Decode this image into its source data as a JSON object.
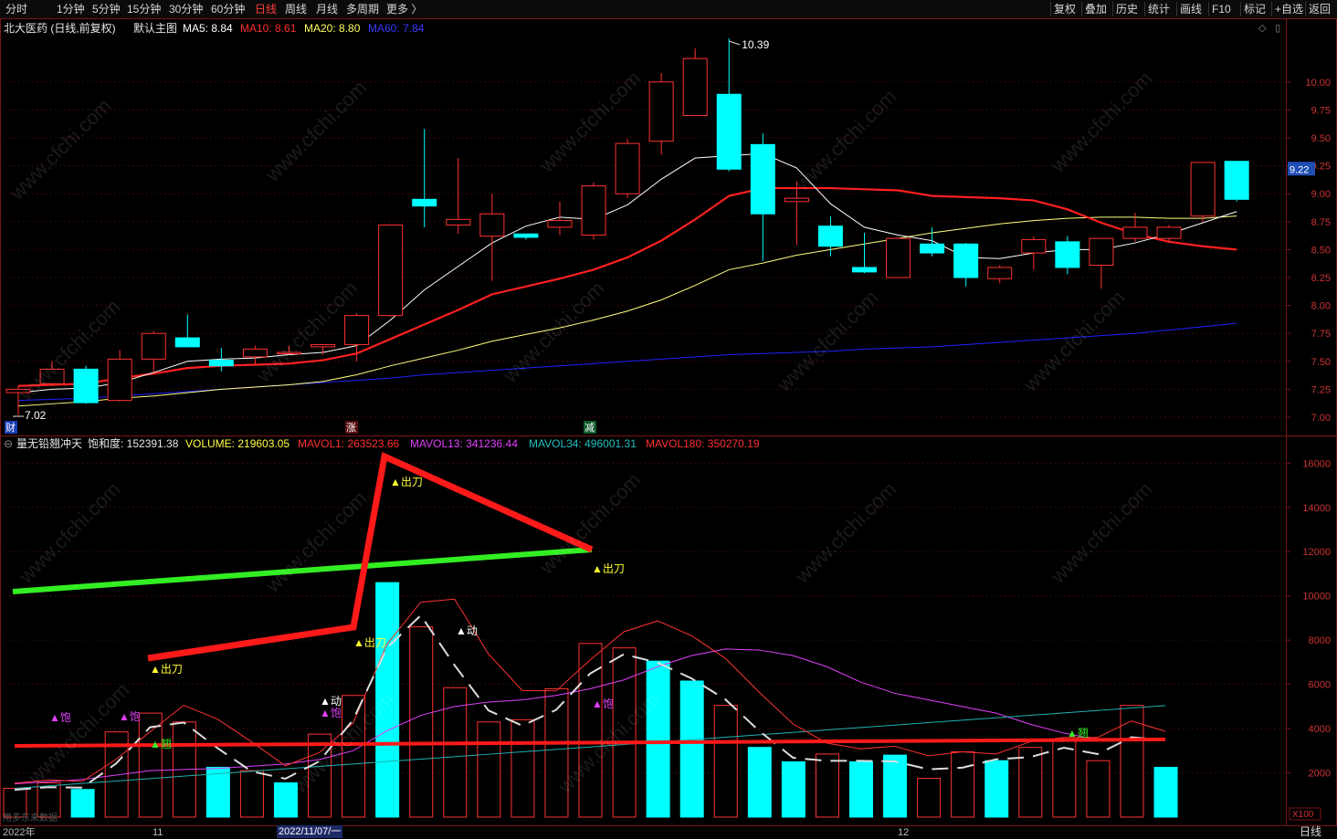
{
  "toolbar": {
    "periods": [
      "分时",
      "1分钟",
      "5分钟",
      "15分钟",
      "30分钟",
      "60分钟",
      "日线",
      "周线",
      "月线",
      "多周期",
      "更多 〉"
    ],
    "active_period": "日线",
    "right_buttons": [
      "复权",
      "叠加",
      "历史",
      "统计",
      "画线",
      "F10",
      "标记",
      "+自选",
      "返回"
    ]
  },
  "main_panel": {
    "stock": "北大医药 (日线,前复权)",
    "template": "默认主图",
    "ma5": "MA5: 8.84",
    "ma10": "MA10: 8.61",
    "ma20": "MA20: 8.80",
    "ma60": "MA60: 7.84",
    "high_label": "10.39",
    "low_label": "7.02",
    "last_price": "9.22",
    "markers": [
      "财",
      "涨",
      "减"
    ]
  },
  "sub_panel": {
    "indicator": "量无铅翘冲天",
    "saturation": "饱和度: 152391.38",
    "volume": "VOLUME: 219603.05",
    "mavol1": "MAVOL1: 263523.66",
    "mavol13": "MAVOL13: 341236.44",
    "mavol34": "MAVOL34: 496001.31",
    "mavol180": "MAVOL180: 350270.19",
    "unit": "X100",
    "signals": {
      "chudao": "▲出刀",
      "dong": "▲动",
      "bao": "▲饱",
      "qiao": "▲翘"
    },
    "watermark_note": "用多东来数据"
  },
  "bottom": {
    "year": "2022年",
    "month_nov": "11",
    "cursor_date": "2022/11/07/一",
    "month_dec": "12",
    "period_tag": "日线"
  },
  "watermark": "www.cfchi.com",
  "colors": {
    "up": "#ff3232",
    "down": "#00ffff",
    "ma5": "#ffffff",
    "ma10": "#ff2020",
    "ma20": "#ffff80",
    "ma60": "#2020ff",
    "purple": "#e040fb",
    "teal": "#20b0b0"
  },
  "chart_data": {
    "type": "candlestick",
    "price_axis": [
      7.0,
      7.25,
      7.5,
      7.75,
      8.0,
      8.25,
      8.5,
      8.75,
      9.0,
      9.25,
      9.5,
      9.75,
      10.0
    ],
    "candles": [
      {
        "o": 7.22,
        "h": 7.28,
        "l": 7.02,
        "c": 7.25
      },
      {
        "o": 7.3,
        "h": 7.5,
        "l": 7.28,
        "c": 7.43
      },
      {
        "o": 7.43,
        "h": 7.46,
        "l": 7.12,
        "c": 7.13
      },
      {
        "o": 7.15,
        "h": 7.6,
        "l": 7.14,
        "c": 7.52
      },
      {
        "o": 7.52,
        "h": 7.77,
        "l": 7.4,
        "c": 7.75
      },
      {
        "o": 7.71,
        "h": 7.92,
        "l": 7.63,
        "c": 7.63
      },
      {
        "o": 7.51,
        "h": 7.62,
        "l": 7.41,
        "c": 7.46
      },
      {
        "o": 7.54,
        "h": 7.64,
        "l": 7.47,
        "c": 7.61
      },
      {
        "o": 7.58,
        "h": 7.64,
        "l": 7.56,
        "c": 7.58
      },
      {
        "o": 7.63,
        "h": 7.65,
        "l": 7.56,
        "c": 7.65
      },
      {
        "o": 7.65,
        "h": 7.93,
        "l": 7.5,
        "c": 7.91
      },
      {
        "o": 7.91,
        "h": 8.72,
        "l": 7.9,
        "c": 8.72
      },
      {
        "o": 8.95,
        "h": 9.58,
        "l": 8.7,
        "c": 8.89
      },
      {
        "o": 8.72,
        "h": 9.32,
        "l": 8.64,
        "c": 8.77
      },
      {
        "o": 8.62,
        "h": 9.0,
        "l": 8.22,
        "c": 8.82
      },
      {
        "o": 8.64,
        "h": 8.64,
        "l": 8.59,
        "c": 8.61
      },
      {
        "o": 8.7,
        "h": 8.93,
        "l": 8.63,
        "c": 8.76
      },
      {
        "o": 8.63,
        "h": 9.1,
        "l": 8.59,
        "c": 9.07
      },
      {
        "o": 9.0,
        "h": 9.49,
        "l": 8.96,
        "c": 9.45
      },
      {
        "o": 9.47,
        "h": 10.08,
        "l": 9.35,
        "c": 10.0
      },
      {
        "o": 9.7,
        "h": 10.3,
        "l": 9.7,
        "c": 10.21
      },
      {
        "o": 9.89,
        "h": 10.39,
        "l": 9.2,
        "c": 9.22
      },
      {
        "o": 9.44,
        "h": 9.54,
        "l": 8.4,
        "c": 8.82
      },
      {
        "o": 8.93,
        "h": 9.11,
        "l": 8.54,
        "c": 8.96
      },
      {
        "o": 8.71,
        "h": 8.8,
        "l": 8.44,
        "c": 8.53
      },
      {
        "o": 8.34,
        "h": 8.65,
        "l": 8.29,
        "c": 8.3
      },
      {
        "o": 8.25,
        "h": 8.6,
        "l": 8.25,
        "c": 8.6
      },
      {
        "o": 8.55,
        "h": 8.7,
        "l": 8.44,
        "c": 8.47
      },
      {
        "o": 8.55,
        "h": 8.56,
        "l": 8.17,
        "c": 8.25
      },
      {
        "o": 8.24,
        "h": 8.36,
        "l": 8.2,
        "c": 8.34
      },
      {
        "o": 8.47,
        "h": 8.62,
        "l": 8.32,
        "c": 8.59
      },
      {
        "o": 8.57,
        "h": 8.62,
        "l": 8.28,
        "c": 8.34
      },
      {
        "o": 8.36,
        "h": 8.6,
        "l": 8.15,
        "c": 8.6
      },
      {
        "o": 8.6,
        "h": 8.83,
        "l": 8.57,
        "c": 8.7
      },
      {
        "o": 8.6,
        "h": 8.72,
        "l": 8.56,
        "c": 8.7
      },
      {
        "o": 8.8,
        "h": 9.28,
        "l": 8.75,
        "c": 9.28
      },
      {
        "o": 9.29,
        "h": 9.29,
        "l": 8.93,
        "c": 8.95
      }
    ],
    "ma5": [
      7.22,
      7.25,
      7.26,
      7.31,
      7.4,
      7.5,
      7.52,
      7.53,
      7.56,
      7.58,
      7.64,
      7.87,
      8.14,
      8.35,
      8.56,
      8.71,
      8.79,
      8.77,
      8.9,
      9.13,
      9.32,
      9.34,
      9.36,
      9.23,
      8.91,
      8.7,
      8.63,
      8.58,
      8.43,
      8.42,
      8.47,
      8.5,
      8.5,
      8.56,
      8.64,
      8.74,
      8.84
    ],
    "ma10": [
      7.28,
      7.29,
      7.3,
      7.35,
      7.39,
      7.44,
      7.46,
      7.47,
      7.48,
      7.51,
      7.57,
      7.7,
      7.83,
      7.96,
      8.1,
      8.17,
      8.24,
      8.32,
      8.43,
      8.58,
      8.77,
      8.98,
      9.05,
      9.05,
      9.05,
      9.04,
      9.03,
      8.98,
      8.97,
      8.96,
      8.94,
      8.86,
      8.74,
      8.64,
      8.57,
      8.53,
      8.5,
      8.49,
      8.49,
      8.56,
      8.61
    ],
    "ma20": [
      7.1,
      7.12,
      7.14,
      7.17,
      7.19,
      7.22,
      7.25,
      7.27,
      7.29,
      7.32,
      7.38,
      7.46,
      7.53,
      7.6,
      7.68,
      7.74,
      7.8,
      7.87,
      7.95,
      8.05,
      8.18,
      8.32,
      8.38,
      8.45,
      8.5,
      8.55,
      8.6,
      8.65,
      8.69,
      8.73,
      8.76,
      8.78,
      8.79,
      8.79,
      8.78,
      8.78,
      8.8
    ],
    "ma60": [
      7.15,
      7.16,
      7.17,
      7.19,
      7.21,
      7.23,
      7.25,
      7.27,
      7.29,
      7.31,
      7.33,
      7.35,
      7.38,
      7.4,
      7.42,
      7.44,
      7.46,
      7.48,
      7.5,
      7.52,
      7.54,
      7.56,
      7.57,
      7.58,
      7.59,
      7.61,
      7.62,
      7.63,
      7.65,
      7.67,
      7.69,
      7.71,
      7.73,
      7.75,
      7.78,
      7.81,
      7.84
    ],
    "vol_axis": [
      2000,
      4000,
      6000,
      8000,
      10000,
      12000,
      14000,
      16000
    ],
    "volumes": [
      1300,
      1550,
      1250,
      3850,
      4700,
      4300,
      2250,
      2100,
      1550,
      3750,
      5500,
      10600,
      8600,
      5850,
      4300,
      4400,
      5800,
      7850,
      7650,
      7050,
      6150,
      5050,
      3150,
      2500,
      2850,
      2500,
      2800,
      1750,
      2950,
      2550,
      3150,
      3450,
      2550,
      5050,
      2250
    ],
    "vol_down": [
      false,
      false,
      true,
      false,
      false,
      false,
      true,
      false,
      true,
      false,
      false,
      true,
      false,
      false,
      false,
      false,
      false,
      false,
      false,
      true,
      true,
      false,
      true,
      true,
      false,
      true,
      true,
      false,
      false,
      true,
      false,
      false,
      false,
      false,
      true
    ],
    "mavol13": [
      1500,
      1600,
      1700,
      1900,
      2100,
      2150,
      2200,
      2300,
      2400,
      2600,
      3000,
      3900,
      4600,
      5000,
      5200,
      5300,
      5500,
      5800,
      6200,
      6800,
      7300,
      7600,
      7550,
      7300,
      6800,
      6100,
      5600,
      5300,
      5000,
      4700,
      4200,
      3800,
      3500
    ]
  }
}
